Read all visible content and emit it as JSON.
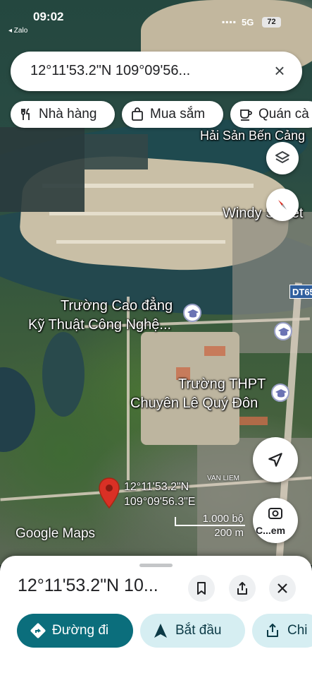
{
  "status": {
    "time": "09:02",
    "back_app": "◂ Zalo",
    "network": "5G",
    "battery": "72"
  },
  "search": {
    "query": "12°11'53.2\"N 109°09'56..."
  },
  "chips": [
    "Nhà hàng",
    "Mua sắm",
    "Quán cà"
  ],
  "map_labels": {
    "restaurant": "Hải Sản Bến Cảng",
    "hotel": "Windy Street",
    "college_line1": "Trường Cao đẳng",
    "college_line2": "Kỹ Thuật Công Nghệ...",
    "school_line1": "Trường THPT",
    "school_line2": "Chuyên Lê Quý Đôn",
    "road_badge": "DT65",
    "pin_line1": "12°11'53.2\"N",
    "pin_line2": "109°09'56.3\"E",
    "area_small": "VAN LIEM"
  },
  "brand": "Google Maps",
  "scale": {
    "top": "1.000 bộ",
    "bottom": "200 m"
  },
  "cam_label": "C...em",
  "sheet": {
    "title": "12°11'53.2\"N 10...",
    "actions": [
      {
        "label": "Đường đi"
      },
      {
        "label": "Bắt đầu"
      },
      {
        "label": "Chi"
      }
    ]
  },
  "colors": {
    "primary": "#0b6e7c",
    "secondary_bg": "#d6eef2",
    "pin": "#d93025",
    "poi_border": "#9aa0c8"
  }
}
